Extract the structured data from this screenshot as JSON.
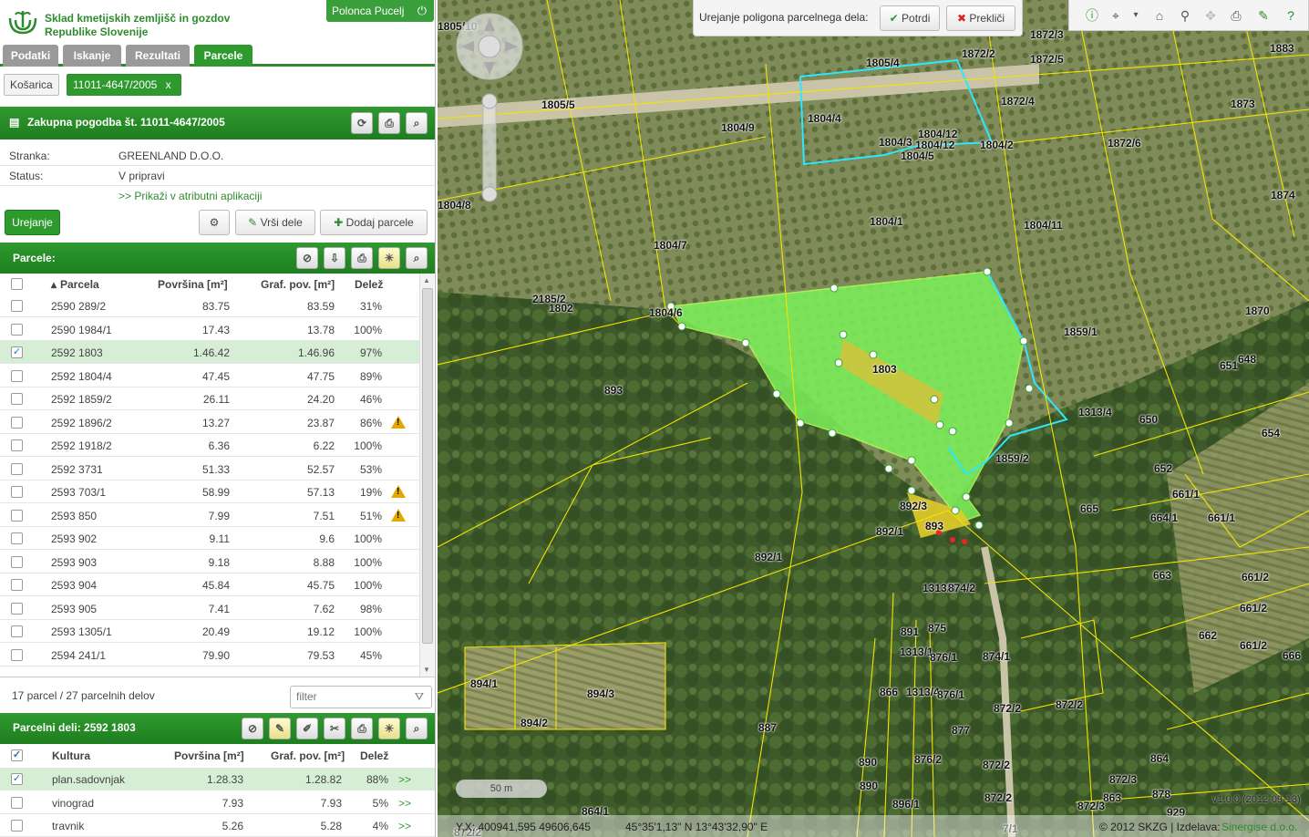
{
  "header": {
    "org_line1": "Sklad kmetijskih zemljišč in gozdov",
    "org_line2": "Republike Slovenije",
    "user": "Polonca Pucelj"
  },
  "tabs": [
    {
      "label": "Podatki"
    },
    {
      "label": "Iskanje"
    },
    {
      "label": "Rezultati"
    },
    {
      "label": "Parcele",
      "active": true
    }
  ],
  "crumbs": {
    "basket": "Košarica",
    "doc": "11011-4647/2005",
    "close": "x"
  },
  "contract": {
    "title": "Zakupna pogodba št. 11011-4647/2005",
    "client_label": "Stranka:",
    "client": "GREENLAND D.O.O.",
    "status_label": "Status:",
    "status": "V pripravi",
    "link": ">> Prikaži v atributni aplikaciji"
  },
  "actions": {
    "edit": "Urejanje",
    "return": "Vrši dele",
    "add": "Dodaj parcele"
  },
  "parcels": {
    "title": "Parcele:",
    "col_parcel": "Parcela",
    "col_area": "Površina [m²]",
    "col_graf": "Graf. pov. [m²]",
    "col_share": "Delež",
    "rows": [
      {
        "parcel": "2590 289/2",
        "area": "83.75",
        "graf": "83.59",
        "share": "31%",
        "checked": false,
        "warn": false
      },
      {
        "parcel": "2590 1984/1",
        "area": "17.43",
        "graf": "13.78",
        "share": "100%",
        "checked": false,
        "warn": false
      },
      {
        "parcel": "2592 1803",
        "area": "1.46.42",
        "graf": "1.46.96",
        "share": "97%",
        "checked": true,
        "warn": false
      },
      {
        "parcel": "2592 1804/4",
        "area": "47.45",
        "graf": "47.75",
        "share": "89%",
        "checked": false,
        "warn": false
      },
      {
        "parcel": "2592 1859/2",
        "area": "26.11",
        "graf": "24.20",
        "share": "46%",
        "checked": false,
        "warn": false
      },
      {
        "parcel": "2592 1896/2",
        "area": "13.27",
        "graf": "23.87",
        "share": "86%",
        "checked": false,
        "warn": true
      },
      {
        "parcel": "2592 1918/2",
        "area": "6.36",
        "graf": "6.22",
        "share": "100%",
        "checked": false,
        "warn": false
      },
      {
        "parcel": "2592 3731",
        "area": "51.33",
        "graf": "52.57",
        "share": "53%",
        "checked": false,
        "warn": false
      },
      {
        "parcel": "2593 703/1",
        "area": "58.99",
        "graf": "57.13",
        "share": "19%",
        "checked": false,
        "warn": true
      },
      {
        "parcel": "2593 850",
        "area": "7.99",
        "graf": "7.51",
        "share": "51%",
        "checked": false,
        "warn": true
      },
      {
        "parcel": "2593 902",
        "area": "9.11",
        "graf": "9.6",
        "share": "100%",
        "checked": false,
        "warn": false
      },
      {
        "parcel": "2593 903",
        "area": "9.18",
        "graf": "8.88",
        "share": "100%",
        "checked": false,
        "warn": false
      },
      {
        "parcel": "2593 904",
        "area": "45.84",
        "graf": "45.75",
        "share": "100%",
        "checked": false,
        "warn": false
      },
      {
        "parcel": "2593 905",
        "area": "7.41",
        "graf": "7.62",
        "share": "98%",
        "checked": false,
        "warn": false
      },
      {
        "parcel": "2593 1305/1",
        "area": "20.49",
        "graf": "19.12",
        "share": "100%",
        "checked": false,
        "warn": false
      },
      {
        "parcel": "2594 241/1",
        "area": "79.90",
        "graf": "79.53",
        "share": "45%",
        "checked": false,
        "warn": false
      }
    ],
    "summary": "17 parcel / 27 parcelnih delov",
    "filter_placeholder": "filter"
  },
  "parts": {
    "title": "Parcelni deli: 2592 1803",
    "col_culture": "Kultura",
    "col_area": "Površina [m²]",
    "col_graf": "Graf. pov. [m²]",
    "col_share": "Delež",
    "rows": [
      {
        "culture": "plan.sadovnjak",
        "area": "1.28.33",
        "graf": "1.28.82",
        "share": "88%",
        "link": ">>",
        "checked": true
      },
      {
        "culture": "vinograd",
        "area": "7.93",
        "graf": "7.93",
        "share": "5%",
        "link": ">>",
        "checked": false
      },
      {
        "culture": "travnik",
        "area": "5.26",
        "graf": "5.28",
        "share": "4%",
        "link": ">>",
        "checked": false
      }
    ]
  },
  "map": {
    "edit_title": "Urejanje poligona parcelnega dela:",
    "confirm": "Potrdi",
    "cancel": "Prekliči",
    "scale": "50 m",
    "coords": "Y,X: 400941,595 49606,645",
    "latlon": "45°35'1,13\" N 13°43'32,90\" E",
    "copyright": "© 2012 SKZG | Izdelava:",
    "maker": "Sinergise d.o.o.",
    "version": "v1.0.0 (2012-09-13)",
    "labels": [
      "1805/10",
      "1805/4",
      "1872/2",
      "1872/3",
      "1872/5",
      "1883",
      "1805/5",
      "1804/4",
      "1804/12",
      "1804/3",
      "1804/12",
      "1804/2",
      "1804/5",
      "1804/9",
      "1872/4",
      "1873",
      "1872/6",
      "1874",
      "1804/8",
      "1804/1",
      "1804/11",
      "1804/7",
      "2185/2",
      "1802",
      "1804/6",
      "1870",
      "1859/1",
      "1803",
      "893",
      "651",
      "648",
      "1313/4",
      "650",
      "654",
      "1859/2",
      "652",
      "892/3",
      "893",
      "892/1",
      "665",
      "661/1",
      "664/1",
      "661/1",
      "892/1",
      "663",
      "661/2",
      "1313/4",
      "874/2",
      "891",
      "875",
      "1313/1",
      "876/1",
      "874/1",
      "662",
      "661/2",
      "661/2",
      "666",
      "894/1",
      "894/3",
      "894/2",
      "866",
      "1313/4",
      "876/1",
      "872/2",
      "872/2",
      "887",
      "877",
      "890",
      "876/2",
      "872/2",
      "864",
      "890",
      "872/3",
      "872/2",
      "872/3",
      "863",
      "878",
      "896/1",
      "864/1",
      "929",
      "872/2",
      "7/1"
    ]
  }
}
